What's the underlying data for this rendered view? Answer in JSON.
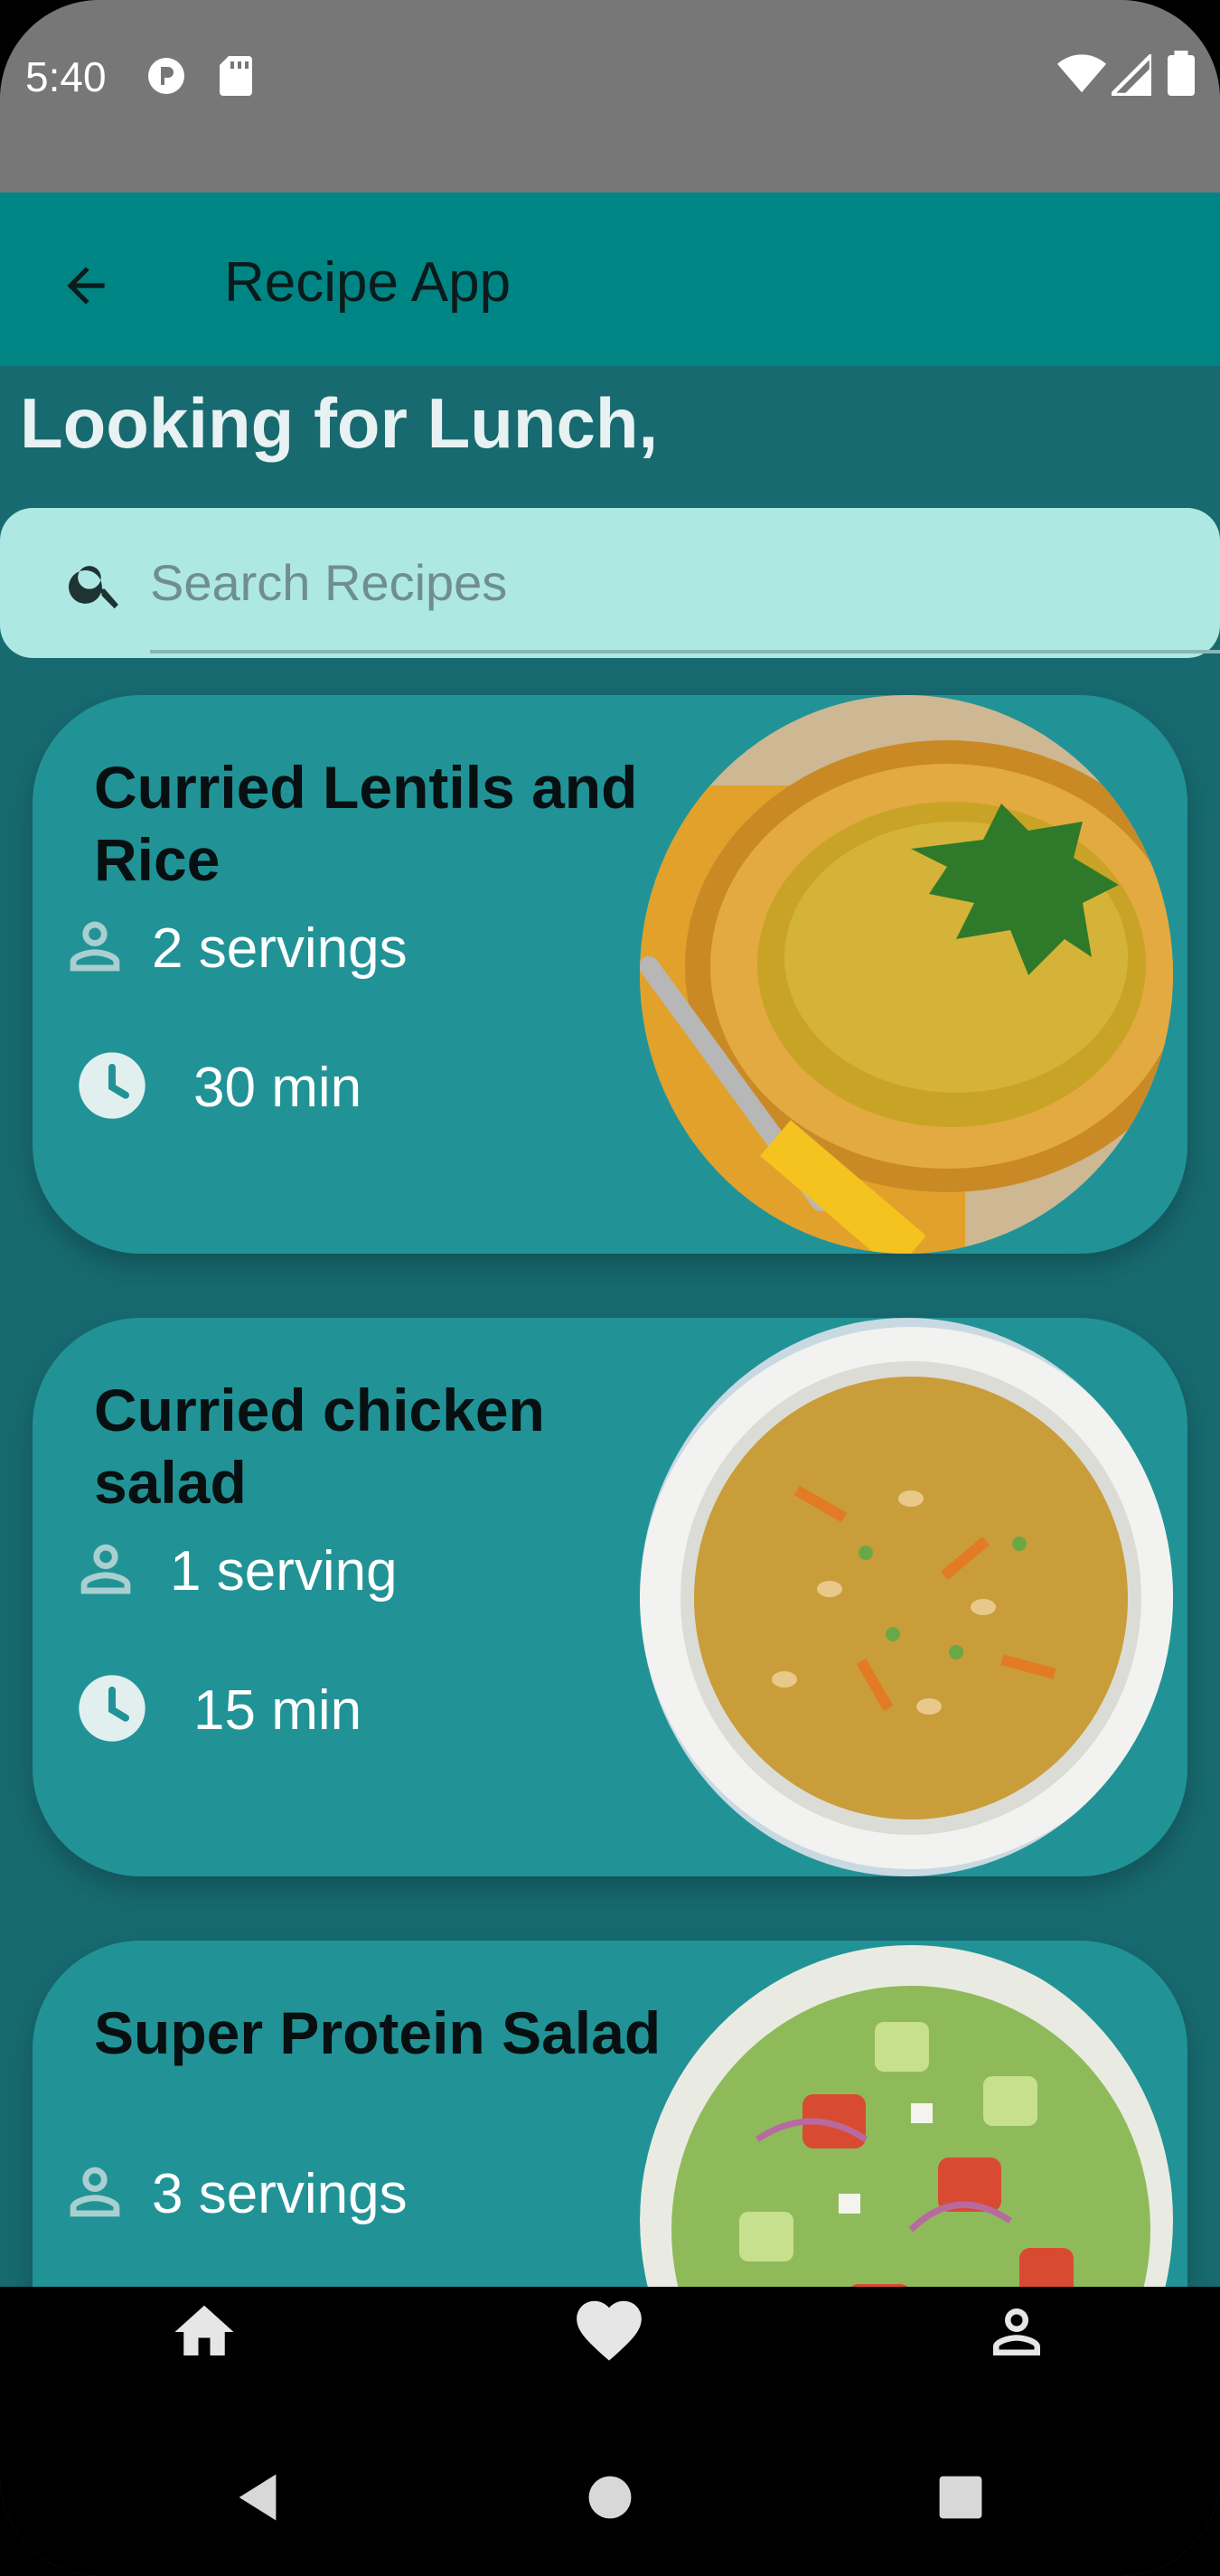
{
  "status_bar": {
    "time": "5:40",
    "icons": [
      "circle-p-icon",
      "sd-card-icon",
      "wifi-icon",
      "signal-icon",
      "battery-icon"
    ]
  },
  "app_bar": {
    "back_icon": "arrow-left-icon",
    "title": "Recipe App"
  },
  "heading": "Looking for Lunch,",
  "search": {
    "placeholder": "Search Recipes",
    "icon": "search-icon"
  },
  "recipes": [
    {
      "title": "Curried Lentils and Rice",
      "servings": "2 servings",
      "time": "30 min"
    },
    {
      "title": "Curried chicken salad",
      "servings": "1 serving",
      "time": "15 min"
    },
    {
      "title": "Super Protein Salad",
      "servings": "3 servings",
      "time": ""
    }
  ],
  "bottom_nav": {
    "items": [
      "home-icon",
      "heart-icon",
      "person-icon"
    ]
  },
  "system_nav": [
    "back-triangle-icon",
    "home-circle-icon",
    "recents-square-icon"
  ],
  "colors": {
    "status_bar": "#777777",
    "app_bar": "#008585",
    "background": "#176a70",
    "card": "#219396",
    "search_bg": "#aee8e2",
    "heading_text": "#e8f2f2"
  }
}
